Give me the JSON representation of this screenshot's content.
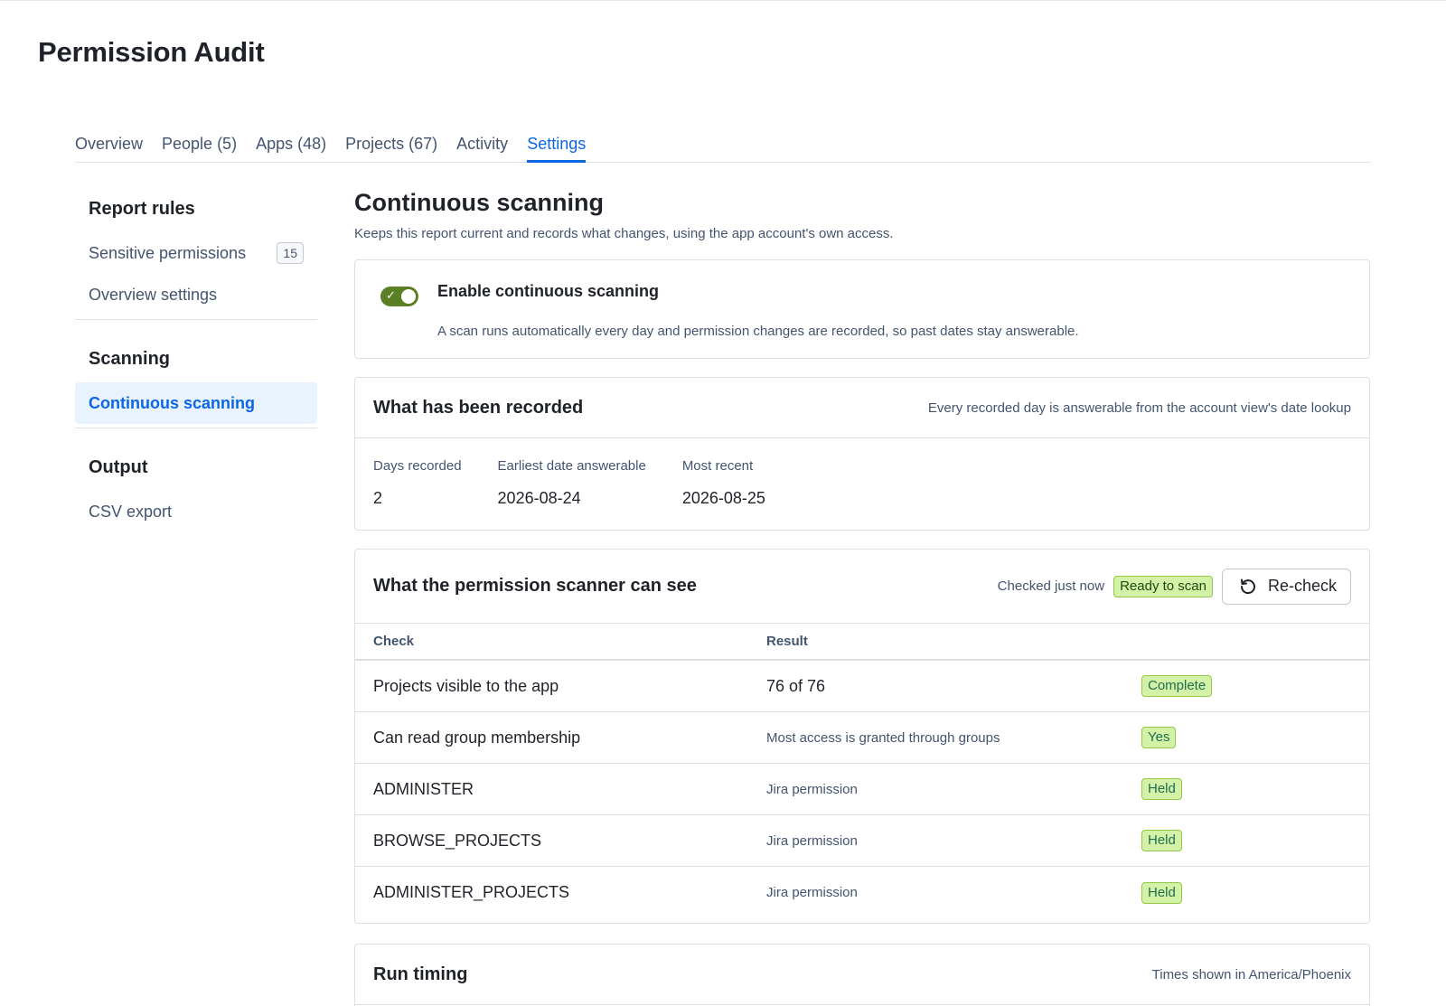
{
  "page": {
    "title": "Permission Audit"
  },
  "tabs": [
    {
      "label": "Overview"
    },
    {
      "label": "People (5)"
    },
    {
      "label": "Apps (48)"
    },
    {
      "label": "Projects (67)"
    },
    {
      "label": "Activity"
    },
    {
      "label": "Settings",
      "active": true
    }
  ],
  "sidebar": {
    "groups": [
      {
        "heading": "Report rules",
        "items": [
          {
            "label": "Sensitive permissions",
            "badge": "15"
          },
          {
            "label": "Overview settings"
          }
        ]
      },
      {
        "heading": "Scanning",
        "items": [
          {
            "label": "Continuous scanning",
            "active": true
          }
        ]
      },
      {
        "heading": "Output",
        "items": [
          {
            "label": "CSV export"
          }
        ]
      }
    ]
  },
  "main": {
    "title": "Continuous scanning",
    "subtitle": "Keeps this report current and records what changes, using the app account's own access.",
    "toggle": {
      "label": "Enable continuous scanning",
      "description": "A scan runs automatically every day and permission changes are recorded, so past dates stay answerable.",
      "enabled": true
    },
    "recorded": {
      "title": "What has been recorded",
      "note": "Every recorded day is answerable from the account view's date lookup",
      "stats": [
        {
          "label": "Days recorded",
          "value": "2"
        },
        {
          "label": "Earliest date answerable",
          "value": "2026-08-24"
        },
        {
          "label": "Most recent",
          "value": "2026-08-25"
        }
      ]
    },
    "scanner": {
      "title": "What the permission scanner can see",
      "checked": "Checked just now",
      "status": "Ready to scan",
      "button": "Re-check",
      "columns": {
        "check": "Check",
        "result": "Result"
      },
      "rows": [
        {
          "check": "Projects visible to the app",
          "result": "76 of 76",
          "status": "Complete"
        },
        {
          "check": "Can read group membership",
          "result": "Most access is granted through groups",
          "status": "Yes"
        },
        {
          "check": "ADMINISTER",
          "result": "Jira permission",
          "status": "Held"
        },
        {
          "check": "BROWSE_PROJECTS",
          "result": "Jira permission",
          "status": "Held"
        },
        {
          "check": "ADMINISTER_PROJECTS",
          "result": "Jira permission",
          "status": "Held"
        }
      ]
    },
    "timing": {
      "title": "Run timing",
      "note": "Times shown in America/Phoenix"
    }
  },
  "colors": {
    "accent": "#0c66e4",
    "success_bg": "#d3f1a7",
    "toggle_on": "#5b7f24"
  }
}
